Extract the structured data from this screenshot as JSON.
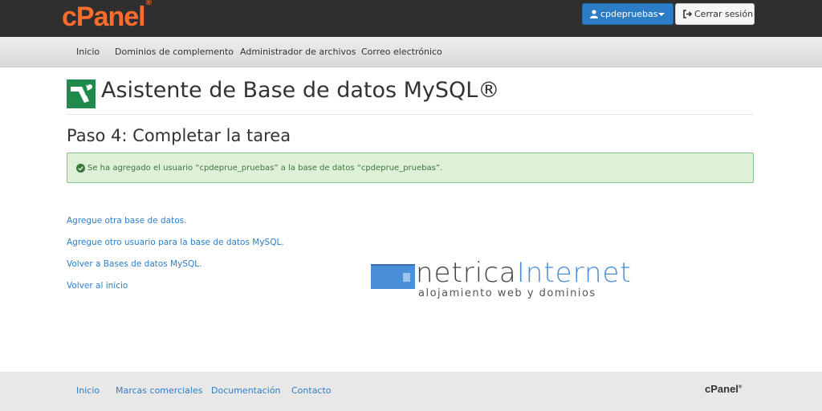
{
  "header": {
    "logo": "cPanel",
    "logo_mark": "®",
    "user_label": "cpdepruebas",
    "logout_label": "Cerrar sesión"
  },
  "nav": {
    "items": [
      "Inicio",
      "Dominios de complemento",
      "Administrador de archivos",
      "Correo electrónico"
    ]
  },
  "page": {
    "title": "Asistente de Base de datos MySQL®",
    "step_title": "Paso 4: Completar la tarea",
    "alert_text": "Se ha agregado el usuario “cpdeprue_pruebas” a la base de datos “cpdeprue_pruebas”.",
    "links": [
      "Agregue otra base de datos.",
      "Agregue otro usuario para la base de datos MySQL.",
      "Volver a Bases de datos MySQL.",
      "Volver al inicio"
    ]
  },
  "brand": {
    "name_part1": "netrica",
    "name_part2": "Internet",
    "tagline": "alojamiento web y dominios"
  },
  "footer": {
    "links": [
      "Inicio",
      "Marcas comerciales",
      "Documentación",
      "Contacto"
    ],
    "logo": "cPanel",
    "logo_mark": "®"
  },
  "colors": {
    "brand_orange": "#ff6c2c",
    "primary_blue": "#2d7dc6",
    "success_bg": "#dff0d8",
    "success_text": "#3c763d"
  }
}
